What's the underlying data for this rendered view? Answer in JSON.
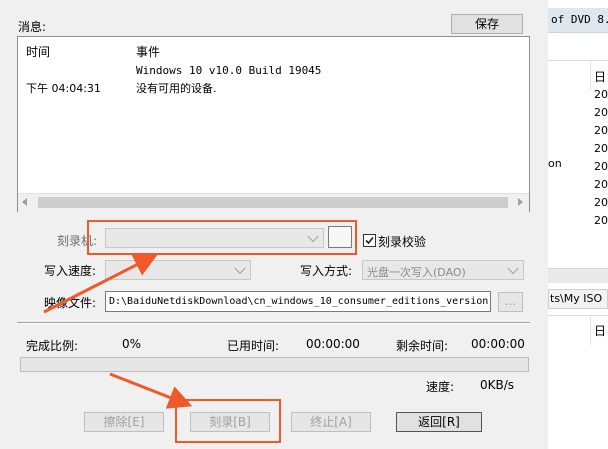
{
  "messages": {
    "label": "消息:",
    "save_button": "保存",
    "columns": [
      "时间",
      "事件"
    ],
    "rows": [
      {
        "time": "",
        "event": "Windows 10 v10.0 Build 19045"
      },
      {
        "time": "下午 04:04:31",
        "event": "没有可用的设备."
      }
    ]
  },
  "burner": {
    "label": "刻录机:",
    "value": "",
    "verify_label": "刻录校验",
    "verify_checked": true
  },
  "write_speed": {
    "label": "写入速度:",
    "value": ""
  },
  "write_mode": {
    "label": "写入方式:",
    "value": "光盘一次写入(DAO)"
  },
  "image_file": {
    "label": "映像文件:",
    "value": "D:\\BaiduNetdiskDownload\\cn_windows_10_consumer_editions_version",
    "browse": "..."
  },
  "progress": {
    "complete_label": "完成比例:",
    "complete_value": "0%",
    "elapsed_label": "已用时间:",
    "elapsed_value": "00:00:00",
    "remaining_label": "剩余时间:",
    "remaining_value": "00:00:00",
    "fill": 0,
    "speed_label": "速度:",
    "speed_value": "0KB/s"
  },
  "buttons": {
    "erase": "擦除[E]",
    "burn": "刻录[B]",
    "stop": "终止[A]",
    "back": "返回[R]"
  },
  "background": {
    "top_text": "of DVD 8.",
    "header": "日",
    "years": [
      "20",
      "20",
      "20",
      "20",
      "20",
      "20",
      "20",
      "20"
    ],
    "side_text": "on",
    "path_text": "ts\\My ISO"
  },
  "colors": {
    "annotation": "#f0592a"
  }
}
